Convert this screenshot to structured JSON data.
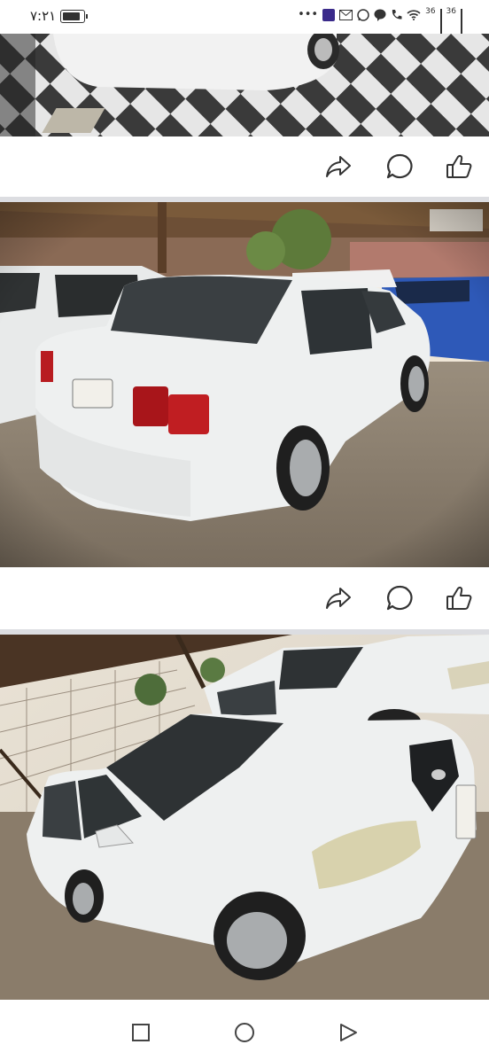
{
  "status_bar": {
    "time": "٧:٢١",
    "network_1": "36",
    "network_2": "36",
    "icons": [
      "battery-icon",
      "more-dots-icon",
      "app-notification-icon",
      "gmail-icon",
      "whatsapp-icon",
      "messenger-icon",
      "phone-icon",
      "wifi-icon",
      "signal-icon",
      "signal-icon"
    ]
  },
  "feed": {
    "posts": [
      {
        "image": "car-photo-tiled-floor",
        "actions": [
          "share-icon",
          "comment-icon",
          "like-icon"
        ]
      },
      {
        "image": "white-sedan-rear-view",
        "actions": [
          "share-icon",
          "comment-icon",
          "like-icon"
        ]
      },
      {
        "image": "white-sedan-front-view",
        "actions": []
      }
    ]
  },
  "nav_bar": {
    "buttons": [
      "recents-button",
      "home-button",
      "back-button"
    ]
  },
  "colors": {
    "divider": "#dcdde1",
    "icon": "#333333",
    "car_white": "#eef0f0"
  }
}
